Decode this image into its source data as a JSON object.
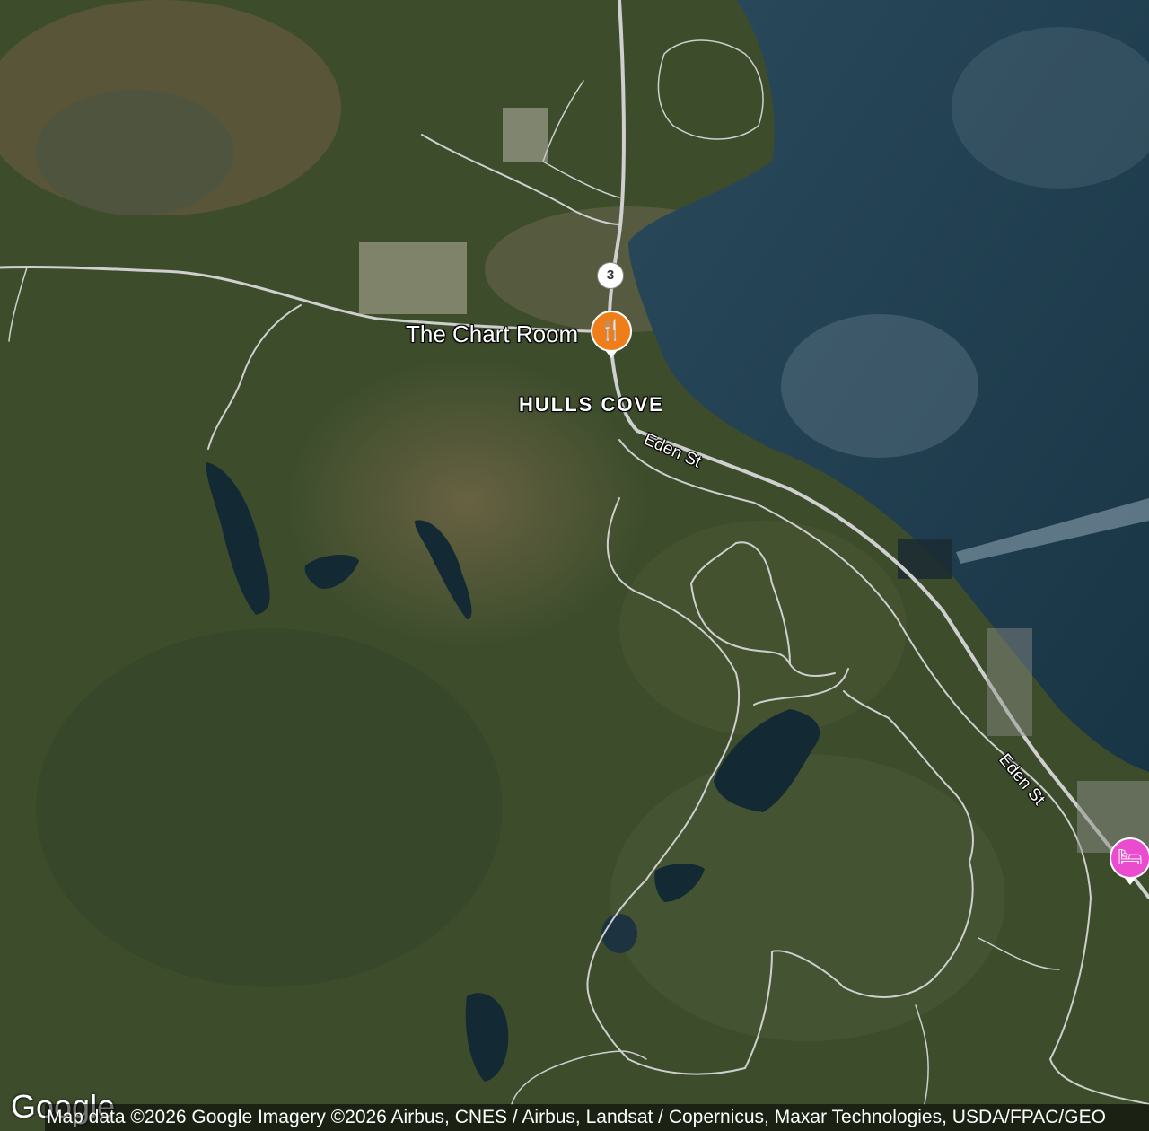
{
  "map": {
    "type": "satellite",
    "place_label": "HULLS COVE",
    "route_shield": "3",
    "road_labels": [
      "Eden St",
      "Eden St"
    ],
    "pois": [
      {
        "name": "The Chart Room",
        "category": "restaurant",
        "icon": "fork-knife-icon",
        "color": "#ef7d1a"
      },
      {
        "name": "",
        "category": "hotel",
        "icon": "bed-icon",
        "color": "#ea4ccf"
      }
    ],
    "logo": "Google",
    "attribution": "Map data ©2026 Google Imagery ©2026 Airbus, CNES / Airbus, Landsat / Copernicus, Maxar Technologies, USDA/FPAC/GEO",
    "colors": {
      "water": "#1c3a4c",
      "forest": "#3a4a2a",
      "road": "#c9c9c9",
      "restaurant_pin": "#ef7d1a",
      "hotel_pin": "#ea4ccf"
    }
  }
}
